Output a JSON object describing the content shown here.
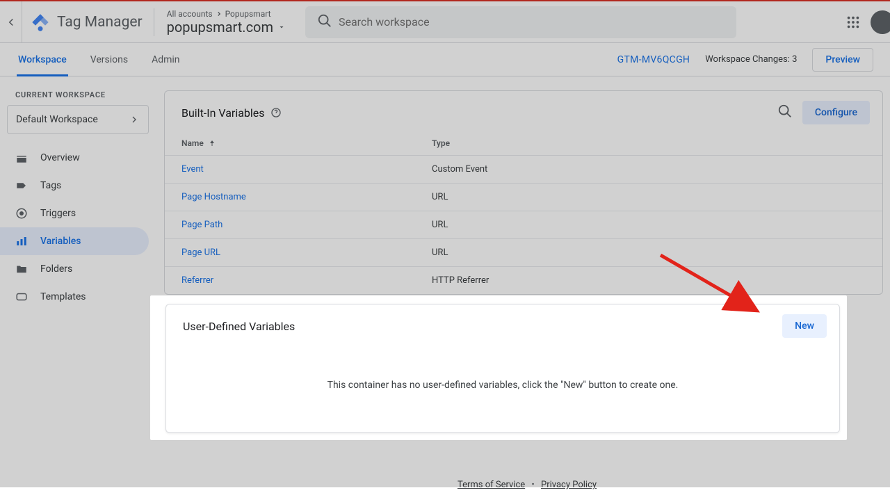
{
  "header": {
    "app_title": "Tag Manager",
    "breadcrumb_all": "All accounts",
    "breadcrumb_acct": "Popupsmart",
    "breadcrumb_container": "popupsmart.com",
    "search_placeholder": "Search workspace"
  },
  "subheader": {
    "tabs": [
      "Workspace",
      "Versions",
      "Admin"
    ],
    "container_id": "GTM-MV6QCGH",
    "changes_label": "Workspace Changes:",
    "changes_count": "3",
    "preview_label": "Preview"
  },
  "sidebar": {
    "current_ws_label": "CURRENT WORKSPACE",
    "ws_name": "Default Workspace",
    "nav": [
      {
        "label": "Overview"
      },
      {
        "label": "Tags"
      },
      {
        "label": "Triggers"
      },
      {
        "label": "Variables"
      },
      {
        "label": "Folders"
      },
      {
        "label": "Templates"
      }
    ]
  },
  "builtin": {
    "title": "Built-In Variables",
    "configure": "Configure",
    "col_name": "Name",
    "col_type": "Type",
    "rows": [
      {
        "name": "Event",
        "type": "Custom Event"
      },
      {
        "name": "Page Hostname",
        "type": "URL"
      },
      {
        "name": "Page Path",
        "type": "URL"
      },
      {
        "name": "Page URL",
        "type": "URL"
      },
      {
        "name": "Referrer",
        "type": "HTTP Referrer"
      }
    ]
  },
  "userdef": {
    "title": "User-Defined Variables",
    "new_label": "New",
    "empty_msg": "This container has no user-defined variables, click the \"New\" button to create one."
  },
  "footer": {
    "tos": "Terms of Service",
    "privacy": "Privacy Policy"
  }
}
